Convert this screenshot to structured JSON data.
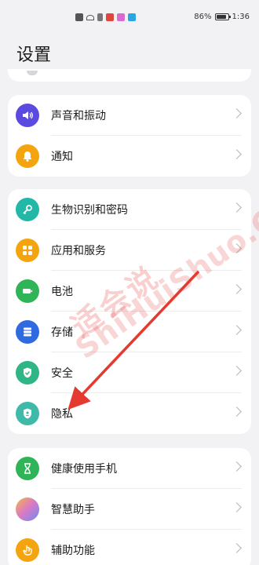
{
  "status_bar": {
    "battery_percent": "86%",
    "time": "1:36",
    "battery_level": 0.86
  },
  "page": {
    "title": "设置"
  },
  "groups": [
    {
      "items": [
        {
          "label": "声音和振动",
          "icon": "speaker-icon",
          "color": "#5b4ae0"
        },
        {
          "label": "通知",
          "icon": "bell-icon",
          "color": "#f3a40f"
        }
      ]
    },
    {
      "items": [
        {
          "label": "生物识别和密码",
          "icon": "key-icon",
          "color": "#22b8a8"
        },
        {
          "label": "应用和服务",
          "icon": "apps-grid-icon",
          "color": "#f3a40f"
        },
        {
          "label": "电池",
          "icon": "battery-icon",
          "color": "#2fb558"
        },
        {
          "label": "存储",
          "icon": "storage-icon",
          "color": "#2f6ae0"
        },
        {
          "label": "安全",
          "icon": "shield-check-icon",
          "color": "#2fb586"
        },
        {
          "label": "隐私",
          "icon": "privacy-shield-icon",
          "color": "#3fb9a8"
        }
      ]
    },
    {
      "items": [
        {
          "label": "健康使用手机",
          "icon": "hourglass-icon",
          "color": "#2fb558"
        },
        {
          "label": "智慧助手",
          "icon": "assistant-icon",
          "color": "#d879c8"
        },
        {
          "label": "辅助功能",
          "icon": "hand-icon",
          "color": "#f3a40f"
        }
      ]
    }
  ],
  "watermark": {
    "chinese": "适会说",
    "english": "ShiHuiShuo.Com"
  }
}
